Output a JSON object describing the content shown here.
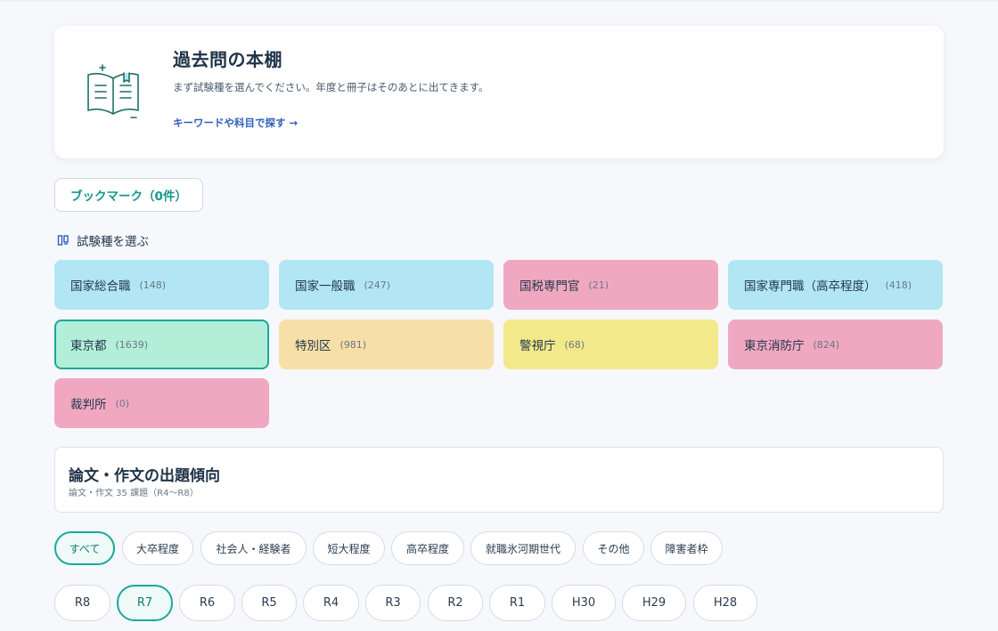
{
  "hero": {
    "title": "過去問の本棚",
    "description": "まず試験種を選んでください。年度と冊子はそのあとに出てきます。",
    "search_link": "キーワードや科目で探す →"
  },
  "bookmark_label": "ブックマーク（0件）",
  "exam_section_label": "試験種を選ぶ",
  "exams": [
    {
      "name": "国家総合職",
      "count": "(148)",
      "color": "blue"
    },
    {
      "name": "国家一般職",
      "count": "(247)",
      "color": "blue"
    },
    {
      "name": "国税専門官",
      "count": "(21)",
      "color": "pink"
    },
    {
      "name": "国家専門職（高卒程度）",
      "count": "(418)",
      "color": "blue"
    },
    {
      "name": "東京都",
      "count": "(1639)",
      "color": "green",
      "selected": true
    },
    {
      "name": "特別区",
      "count": "(981)",
      "color": "peach"
    },
    {
      "name": "警視庁",
      "count": "(68)",
      "color": "yellow"
    },
    {
      "name": "東京消防庁",
      "count": "(824)",
      "color": "pink"
    },
    {
      "name": "裁判所",
      "count": "(0)",
      "color": "pink"
    }
  ],
  "essay": {
    "title": "論文・作文の出題傾向",
    "subtitle": "論文・作文 35 課題（R4〜R8）"
  },
  "categories": [
    {
      "label": "すべて",
      "active": true
    },
    {
      "label": "大卒程度",
      "active": false
    },
    {
      "label": "社会人・経験者",
      "active": false
    },
    {
      "label": "短大程度",
      "active": false
    },
    {
      "label": "高卒程度",
      "active": false
    },
    {
      "label": "就職氷河期世代",
      "active": false
    },
    {
      "label": "その他",
      "active": false
    },
    {
      "label": "障害者枠",
      "active": false
    }
  ],
  "years": [
    {
      "label": "R8",
      "active": false
    },
    {
      "label": "R7",
      "active": true
    },
    {
      "label": "R6",
      "active": false
    },
    {
      "label": "R5",
      "active": false
    },
    {
      "label": "R4",
      "active": false
    },
    {
      "label": "R3",
      "active": false
    },
    {
      "label": "R2",
      "active": false
    },
    {
      "label": "R1",
      "active": false
    },
    {
      "label": "H30",
      "active": false
    },
    {
      "label": "H29",
      "active": false
    },
    {
      "label": "H28",
      "active": false
    }
  ],
  "colors": {
    "accent": "#1aa99c",
    "blue": "#b2e6f5",
    "pink": "#f0a8c0",
    "green": "#b2eed8",
    "peach": "#f7dfa8",
    "yellow": "#f3e98a"
  },
  "icons": {
    "hero": "open-book-icon",
    "section": "bookshelf-icon"
  }
}
